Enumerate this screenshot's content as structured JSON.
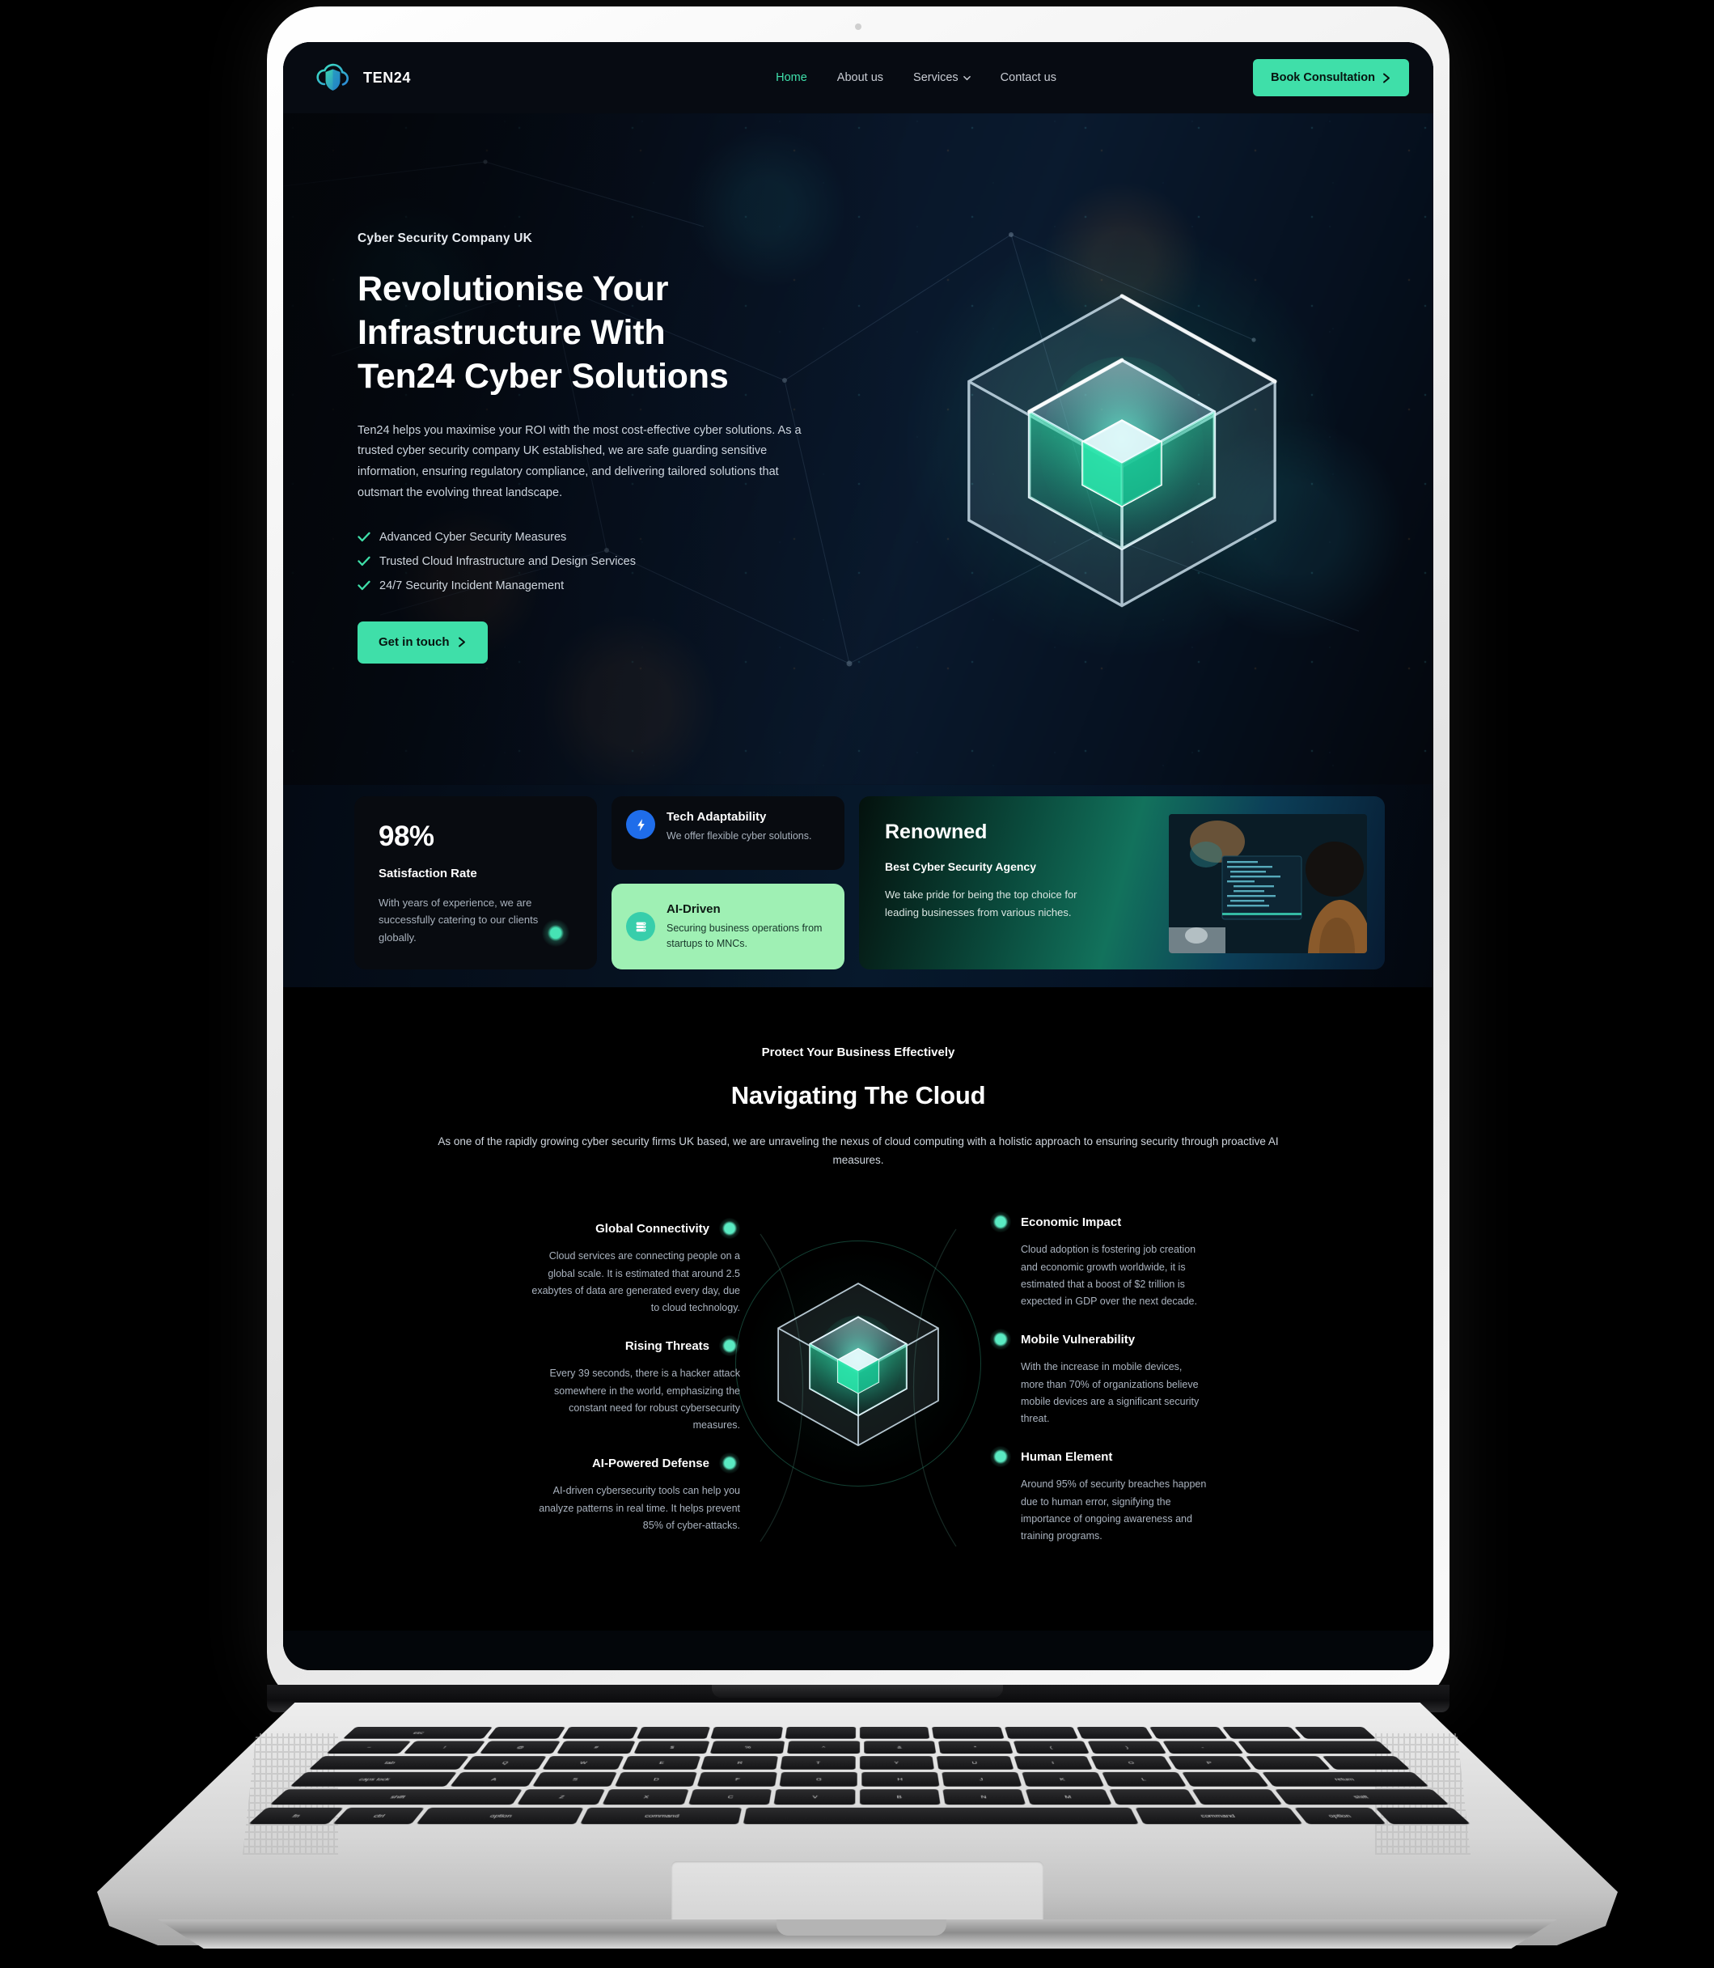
{
  "brand": {
    "name": "TEN24",
    "logo_icon": "cloud-shield-icon"
  },
  "nav": {
    "items": [
      {
        "label": "Home",
        "active": true
      },
      {
        "label": "About us",
        "active": false
      },
      {
        "label": "Services",
        "active": false,
        "has_dropdown": true
      },
      {
        "label": "Contact us",
        "active": false
      }
    ],
    "cta_label": "Book Consultation",
    "cta_icon": "chevron-right-icon",
    "cta_color": "#3fdfa9"
  },
  "hero": {
    "eyebrow": "Cyber Security Company UK",
    "heading_lines": [
      "Revolutionise Your",
      "Infrastructure With",
      "Ten24 Cyber Solutions"
    ],
    "paragraph": "Ten24 helps you maximise your ROI with the most cost-effective cyber solutions. As a trusted cyber security company UK established, we are safe guarding sensitive information, ensuring regulatory compliance, and delivering tailored solutions that outsmart the evolving threat landscape.",
    "checklist": [
      "Advanced Cyber Security Measures",
      "Trusted Cloud Infrastructure and Design Services",
      "24/7 Security Incident Management"
    ],
    "check_icon": "check-tick-icon",
    "button_label": "Get in touch",
    "button_icon": "chevron-right-icon",
    "graphic": "isometric-glass-cube-icon"
  },
  "band": {
    "stat": {
      "value": "98%",
      "label": "Satisfaction Rate",
      "text": "With years of experience, we are successfully catering to our clients globally."
    },
    "mini_cards": [
      {
        "title": "Tech Adaptability",
        "text": "We offer flexible cyber solutions.",
        "icon": "lightning-bolt-icon",
        "icon_color": "#1f6dea",
        "theme": "dark"
      },
      {
        "title": "AI-Driven",
        "text": "Securing business operations from startups to MNCs.",
        "icon": "server-stack-icon",
        "icon_color": "#37ceab",
        "theme": "light"
      }
    ],
    "renowned": {
      "title": "Renowned",
      "subtitle": "Best Cyber Security Agency",
      "text": "We take pride for being the top choice for leading businesses from various niches.",
      "image_alt": "developer-at-monitors-photo"
    }
  },
  "cloud": {
    "kicker": "Protect Your Business Effectively",
    "heading": "Navigating The Cloud",
    "subheading": "As one of the rapidly growing cyber security firms UK based, we are unraveling the nexus of cloud computing with a holistic approach to ensuring security through proactive AI measures.",
    "center_graphic": "isometric-glass-cube-icon",
    "left_items": [
      {
        "title": "Global Connectivity",
        "text": "Cloud services are connecting people on a global scale. It is estimated that around 2.5 exabytes of data are generated every day, due to cloud technology."
      },
      {
        "title": "Rising Threats",
        "text": "Every 39 seconds, there is a hacker attack somewhere in the world, emphasizing the constant need for robust cybersecurity measures."
      },
      {
        "title": "AI-Powered Defense",
        "text": "AI-driven cybersecurity tools can help you analyze patterns in real time. It helps prevent 85% of cyber-attacks."
      }
    ],
    "right_items": [
      {
        "title": "Economic Impact",
        "text": "Cloud adoption is fostering job creation and economic growth worldwide, it is estimated that a boost of $2 trillion is expected in GDP over the next decade."
      },
      {
        "title": "Mobile Vulnerability",
        "text": "With the increase in mobile devices, more than 70% of organizations believe mobile devices are a significant security threat."
      },
      {
        "title": "Human Element",
        "text": "Around 95% of security breaches happen due to human error, signifying the importance of ongoing awareness and training programs."
      }
    ]
  },
  "device": {
    "type": "laptop-mockup",
    "keyboard_rows": [
      [
        "esc",
        "",
        "",
        "",
        "",
        "",
        "",
        "",
        ""
      ],
      [
        "~",
        "!",
        "@",
        "#",
        "$",
        "%",
        "^",
        "&",
        "*"
      ],
      [
        "tab",
        "Q",
        "W",
        "E",
        "R",
        "T",
        "Y",
        "U",
        "I"
      ],
      [
        "caps lock",
        "A",
        "S",
        "D",
        "F",
        "G",
        "H",
        "J",
        "K"
      ],
      [
        "shift",
        "Z",
        "X",
        "C",
        "V",
        "B",
        "N",
        "M",
        ""
      ],
      [
        "fn",
        "ctrl",
        "option",
        "command",
        "",
        "command",
        "option",
        ""
      ]
    ]
  }
}
